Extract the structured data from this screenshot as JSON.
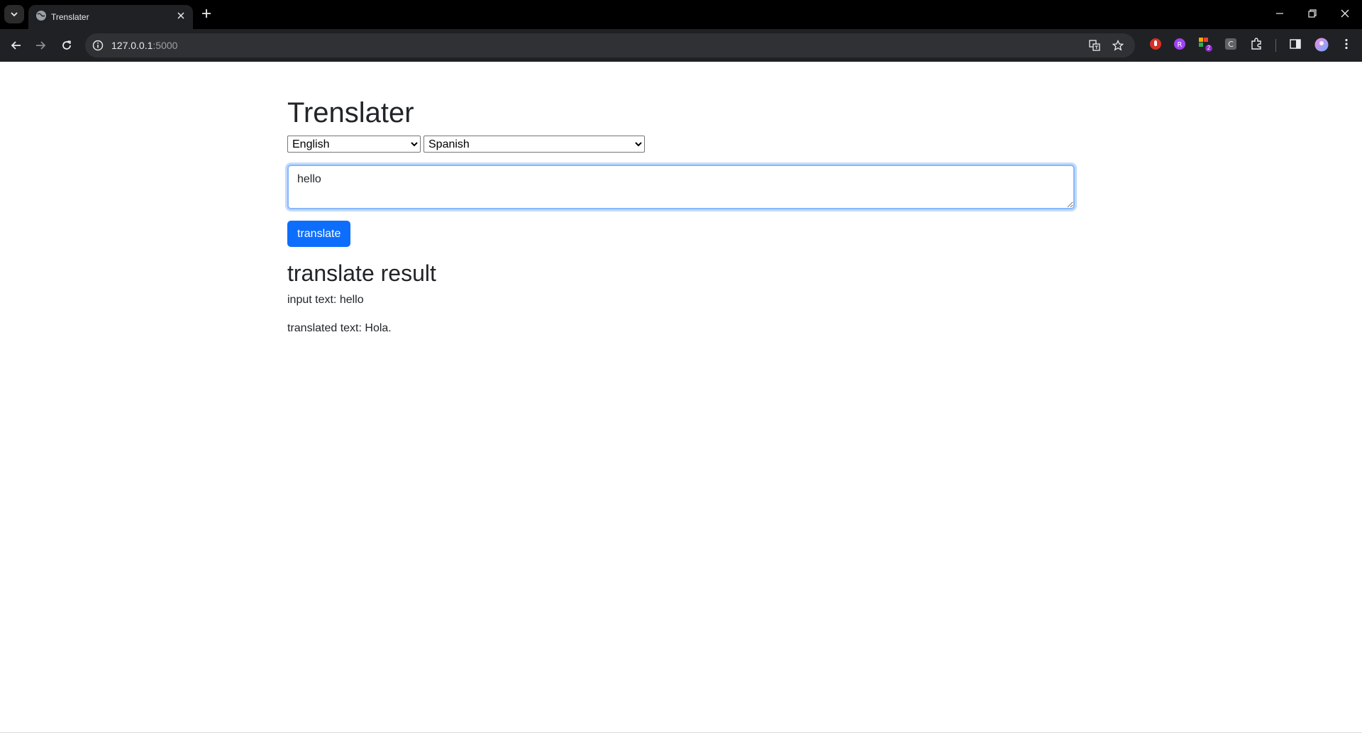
{
  "browser": {
    "tab_title": "Trenslater",
    "url_host": "127.0.0.1",
    "url_port": ":5000",
    "extension_badge": "2",
    "colors": {
      "chrome_bg": "#000000",
      "toolbar_bg": "#202124",
      "omnibox_bg": "#303134"
    }
  },
  "page": {
    "title": "Trenslater",
    "source_language": {
      "selected": "English",
      "options": [
        "English"
      ]
    },
    "target_language": {
      "selected": "Spanish",
      "options": [
        "Spanish"
      ]
    },
    "input_value": "hello",
    "translate_button": "translate",
    "result_heading": "translate result",
    "input_line_label": "input text: ",
    "input_line_value": "hello",
    "translated_line_label": "translated text: ",
    "translated_line_value": "Hola.",
    "colors": {
      "primary_button": "#0d6efd",
      "text": "#212529",
      "focus_border": "#86b7fe"
    }
  }
}
